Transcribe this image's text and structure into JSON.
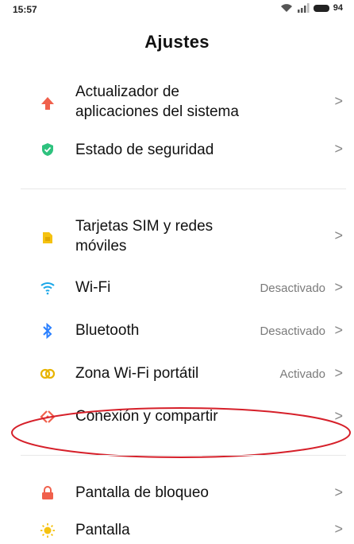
{
  "status_bar": {
    "time": "15:57",
    "battery": "94"
  },
  "header": {
    "title": "Ajustes"
  },
  "items": [
    {
      "label_line1": "Actualizador de",
      "label_line2": "aplicaciones del sistema",
      "icon": "arrow-up-icon",
      "color": "#f0604c"
    },
    {
      "label": "Estado de seguridad",
      "icon": "shield-icon",
      "color": "#2ec27e"
    },
    {
      "label_line1": "Tarjetas SIM y redes",
      "label_line2": "móviles",
      "icon": "sim-card-icon",
      "color": "#f5c211"
    },
    {
      "label": "Wi-Fi",
      "status": "Desactivado",
      "icon": "wifi-icon",
      "color": "#1aa7e8"
    },
    {
      "label": "Bluetooth",
      "status": "Desactivado",
      "icon": "bluetooth-icon",
      "color": "#2a7fff"
    },
    {
      "label": "Zona Wi-Fi portátil",
      "status": "Activado",
      "icon": "hotspot-icon",
      "color": "#e8b400"
    },
    {
      "label": "Conexión y compartir",
      "icon": "connection-share-icon",
      "color": "#f0604c"
    },
    {
      "label": "Pantalla de bloqueo",
      "icon": "lock-icon",
      "color": "#f0604c"
    },
    {
      "label": "Pantalla",
      "icon": "display-brightness-icon",
      "color": "#f5c211"
    }
  ],
  "chevron": ">",
  "annotation": {
    "color": "#d6202a"
  }
}
